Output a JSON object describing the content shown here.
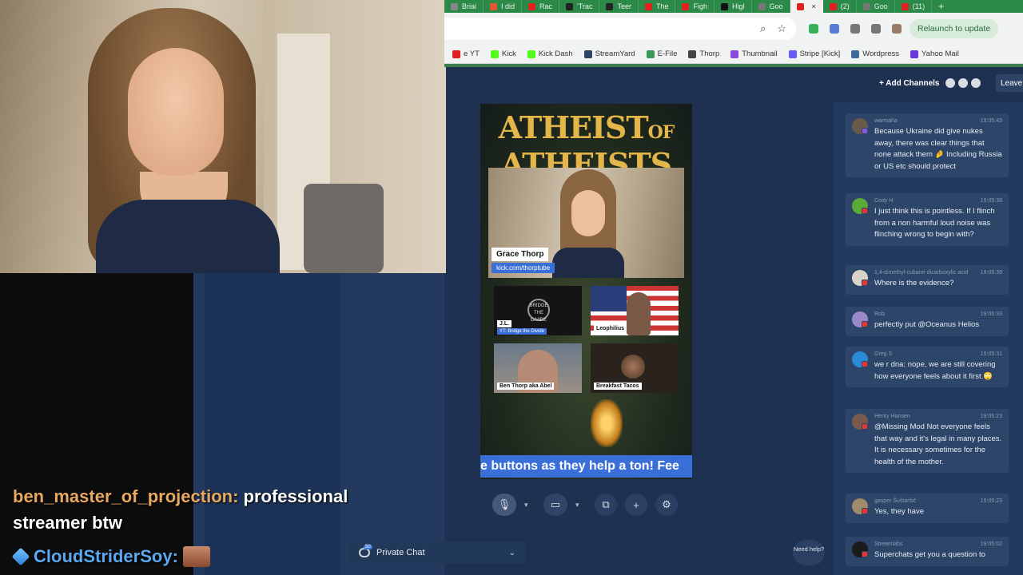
{
  "tabs": [
    {
      "label": "Briai",
      "color": "#888888",
      "active": false
    },
    {
      "label": "I did",
      "color": "#e85533",
      "active": false
    },
    {
      "label": "Rac",
      "color": "#e32020",
      "active": false
    },
    {
      "label": "'Trac",
      "color": "#222222",
      "active": false
    },
    {
      "label": "Teer",
      "color": "#222222",
      "active": false
    },
    {
      "label": "The",
      "color": "#e32020",
      "active": false
    },
    {
      "label": "Figh",
      "color": "#e32020",
      "active": false
    },
    {
      "label": "Higl",
      "color": "#111111",
      "active": false
    },
    {
      "label": "Goo",
      "color": "#777777",
      "active": false
    },
    {
      "label": "",
      "color": "#e32020",
      "active": true
    },
    {
      "label": "(2)",
      "color": "#e32020",
      "active": false
    },
    {
      "label": "Goo",
      "color": "#777777",
      "active": false
    },
    {
      "label": "(11)",
      "color": "#e32020",
      "active": false
    }
  ],
  "address": {
    "relaunch_label": "Relaunch to update",
    "ext_colors": [
      "#3ab05a",
      "#5a7ad8",
      "#777777",
      "#777777",
      "#9a7a6a"
    ]
  },
  "bookmarks": [
    {
      "label": "e YT",
      "color": "#e32020"
    },
    {
      "label": "Kick",
      "color": "#53fc18"
    },
    {
      "label": "Kick Dash",
      "color": "#53fc18"
    },
    {
      "label": "StreamYard",
      "color": "#2d4466"
    },
    {
      "label": "E-File",
      "color": "#3a9a5a"
    },
    {
      "label": "Thorp",
      "color": "#444444"
    },
    {
      "label": "Thumbnail",
      "color": "#8a4ae0"
    },
    {
      "label": "Stripe [Kick]",
      "color": "#635bff"
    },
    {
      "label": "Wordpress",
      "color": "#3a6a9a"
    },
    {
      "label": "Yahoo Mail",
      "color": "#6a3ae0"
    }
  ],
  "overlay": {
    "user1": "ben_master_of_projection:",
    "msg1": " professional streamer btw",
    "user2": "CloudStriderSoy:"
  },
  "studio": {
    "add_channels": "+ Add Channels",
    "leave": "Leave"
  },
  "stage": {
    "title_line1": "ATHEIST",
    "title_of": "OF",
    "title_line2": "ATHEISTS",
    "host_name": "Grace Thorp",
    "host_sub": "kick.com/thorptube",
    "guests": [
      {
        "name": "J.L.",
        "sub": "YT: Bridge the Divide"
      },
      {
        "name": "Leophilius",
        "sub": ""
      },
      {
        "name": "Ben Thorp aka Abel",
        "sub": ""
      },
      {
        "name": "Breakfast Tacos",
        "sub": ""
      }
    ],
    "logo_text": "BRIDGE THE DIVIDE",
    "ticker": "e buttons as they help a ton! Fee"
  },
  "controls": {
    "private_chat": "Private Chat",
    "private_badge": "50",
    "need_help": "Need help?"
  },
  "chat": [
    {
      "user": "warmaha",
      "time": "19:05:43",
      "text": "Because Ukraine did give nukes away, there was clear things that none attack them 🤌 Including Russia or US etc should protect",
      "avatar": "#6a5a4a",
      "badge": "purple"
    },
    {
      "user": "Cody H",
      "time": "19:05:39",
      "text": "I just think this is pointless. If I flinch from a non harmful loud noise was flinching wrong to begin with?",
      "avatar": "#5aaa3a",
      "badge": "red"
    },
    {
      "user": "1,4-dimethyl-cubane-dicarboxylic acid",
      "time": "19:05:39",
      "text": "Where is the evidence?",
      "avatar": "#d8d4c8",
      "badge": "red"
    },
    {
      "user": "Rob",
      "time": "19:05:33",
      "text": "perfectly put @Oceanus Helios",
      "avatar": "#9a8ac8",
      "badge": "red"
    },
    {
      "user": "Greg S",
      "time": "19:05:31",
      "text": "we r dna: nope, we are still covering how everyone feels about it first.🙄",
      "avatar": "#2a8ad8",
      "badge": "red"
    },
    {
      "user": "Henry Hansen",
      "time": "19:05:23",
      "text": "@Missing Mod Not everyone feels that way and it's legal in many places. It is necessary sometimes for the health of the mother.",
      "avatar": "#7a5a4a",
      "badge": "red"
    },
    {
      "user": "gasper Šuštaršič",
      "time": "19:05:23",
      "text": "Yes, they have",
      "avatar": "#a08a6a",
      "badge": "red"
    },
    {
      "user": "Streamlabs",
      "time": "19:05:02",
      "text": "Superchats get you a question to",
      "avatar": "#1a1a1a",
      "badge": "red"
    }
  ]
}
